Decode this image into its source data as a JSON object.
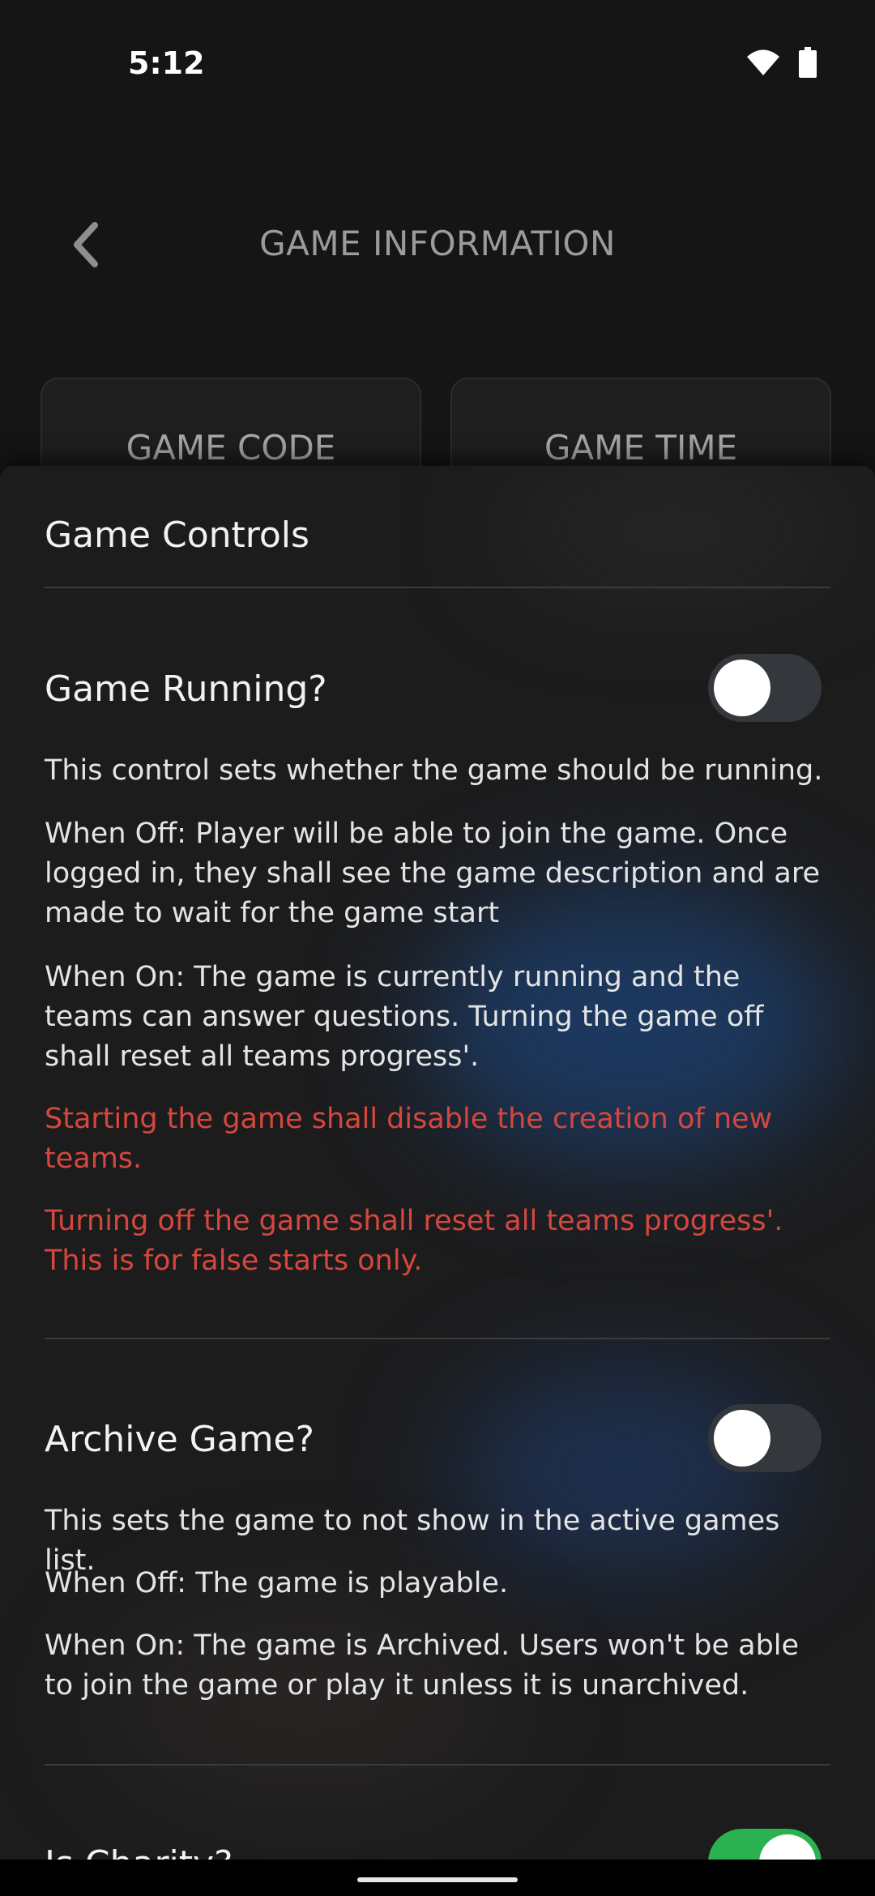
{
  "status_bar": {
    "time": "5:12",
    "icons": [
      "wifi-icon",
      "battery-icon"
    ]
  },
  "header": {
    "title": "GAME INFORMATION",
    "back_icon": "chevron-left-icon"
  },
  "cards": [
    {
      "title": "GAME CODE"
    },
    {
      "title": "GAME TIME"
    }
  ],
  "sheet": {
    "title": "Game Controls",
    "sections": [
      {
        "title": "Game Running?",
        "toggle_on": false,
        "paragraphs": [
          "This control sets whether the game should be running.",
          "When Off: Player will be able to join the game. Once logged in, they shall see the game description and are made to wait for the game start",
          "When On: The game is currently running and the teams can answer questions. Turning the game off shall reset all teams progress'."
        ],
        "warnings": [
          "Starting the game shall disable the creation of new teams.",
          "Turning off the game shall reset all teams progress'. This is for false starts only."
        ]
      },
      {
        "title": "Archive Game?",
        "toggle_on": false,
        "paragraphs": [
          "This sets the game to not show in the active games list.",
          "When Off: The game is playable.",
          "When On: The game is Archived. Users won't be able to join the game or play it unless it is unarchived."
        ]
      },
      {
        "title": "Is Charity?",
        "toggle_on": true
      }
    ]
  },
  "colors": {
    "background": "#151515",
    "sheet": "#1c1c1d",
    "warning": "#d5473e",
    "toggle_on": "#29b24f",
    "toggle_off": "#34373b"
  }
}
